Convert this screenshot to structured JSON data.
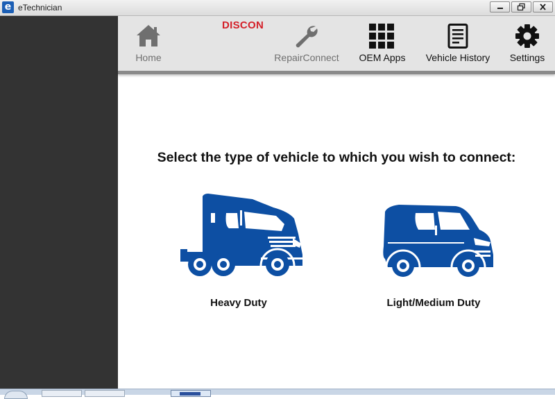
{
  "window": {
    "title": "eTechnician",
    "icon_letter": "e"
  },
  "toolbar": {
    "status": "DISCON",
    "items": [
      {
        "label": "Home",
        "icon": "home-icon",
        "enabled": false
      },
      {
        "label": "RepairConnect",
        "icon": "wrench-icon",
        "enabled": false
      },
      {
        "label": "OEM Apps",
        "icon": "grid-icon",
        "enabled": true
      },
      {
        "label": "Vehicle History",
        "icon": "document-icon",
        "enabled": true
      },
      {
        "label": "Settings",
        "icon": "gear-icon",
        "enabled": true
      }
    ]
  },
  "main": {
    "prompt": "Select the type of vehicle to which you wish to connect:",
    "vehicles": [
      {
        "label": "Heavy Duty",
        "icon": "semi-truck-icon"
      },
      {
        "label": "Light/Medium Duty",
        "icon": "van-icon"
      }
    ]
  },
  "colors": {
    "brand_blue": "#0d4fa3",
    "status_red": "#d41f28",
    "sidebar": "#333333",
    "toolbar": "#e4e4e4",
    "disabled_text": "#6f6f6f"
  }
}
